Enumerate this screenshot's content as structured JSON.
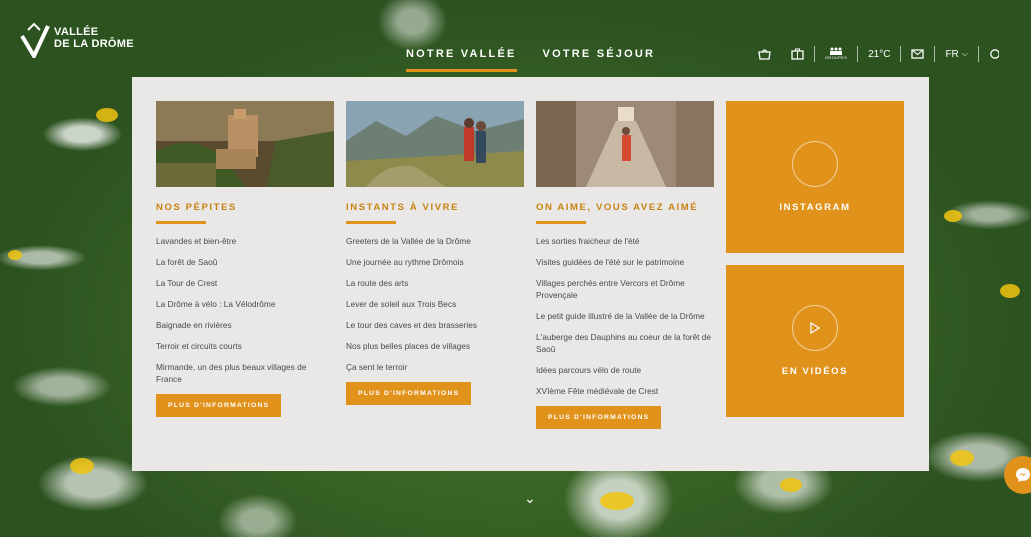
{
  "brand": {
    "line1": "VALLÉE",
    "line2": "DE LA DRÔME"
  },
  "nav": [
    {
      "label": "NOTRE VALLÉE",
      "active": true
    },
    {
      "label": "VOTRE SÉJOUR",
      "active": false
    }
  ],
  "tools": {
    "cart_icon": "bag-icon",
    "suitcase_icon": "suitcase-icon",
    "groupes_label": "GROUPES",
    "weather": "21°C",
    "mail_icon": "mail-icon",
    "lang": "FR"
  },
  "columns": [
    {
      "title": "NOS PÉPITES",
      "items": [
        "Lavandes et bien-être",
        "La forêt de Saoû",
        "La Tour de Crest",
        "La Drôme à vélo : La Vélodrôme",
        "Baignade en rivières",
        "Terroir et circuits courts",
        "Mirmande, un des plus beaux villages de France"
      ],
      "button": "PLUS D'INFORMATIONS"
    },
    {
      "title": "INSTANTS À VIVRE",
      "items": [
        "Greeters de la Vallée de la Drôme",
        "Une journée au rythme Drômois",
        "La route des arts",
        "Lever de soleil aux Trois Becs",
        "Le tour des caves et des brasseries",
        "Nos plus belles places de villages",
        "Ça sent le terroir"
      ],
      "button": "PLUS D'INFORMATIONS"
    },
    {
      "title": "ON AIME, VOUS AVEZ AIMÉ",
      "items": [
        "Les sorties fraicheur de l'été",
        "Visites guidées de l'été sur le patrimoine",
        "Villages perchés entre Vercors et Drôme Provençale",
        "Le petit guide illustré de la Vallée de la Drôme",
        "L'auberge des Dauphins au coeur de la forêt de Saoû",
        "Idées parcours vélo de route",
        "XVIème Fête médiévale de Crest"
      ],
      "button": "PLUS D'INFORMATIONS"
    }
  ],
  "tiles": {
    "instagram": "INSTAGRAM",
    "videos": "EN VIDÉOS"
  },
  "colors": {
    "accent": "#e0921b",
    "panel": "#e9e8e7",
    "title": "#c9820f"
  }
}
